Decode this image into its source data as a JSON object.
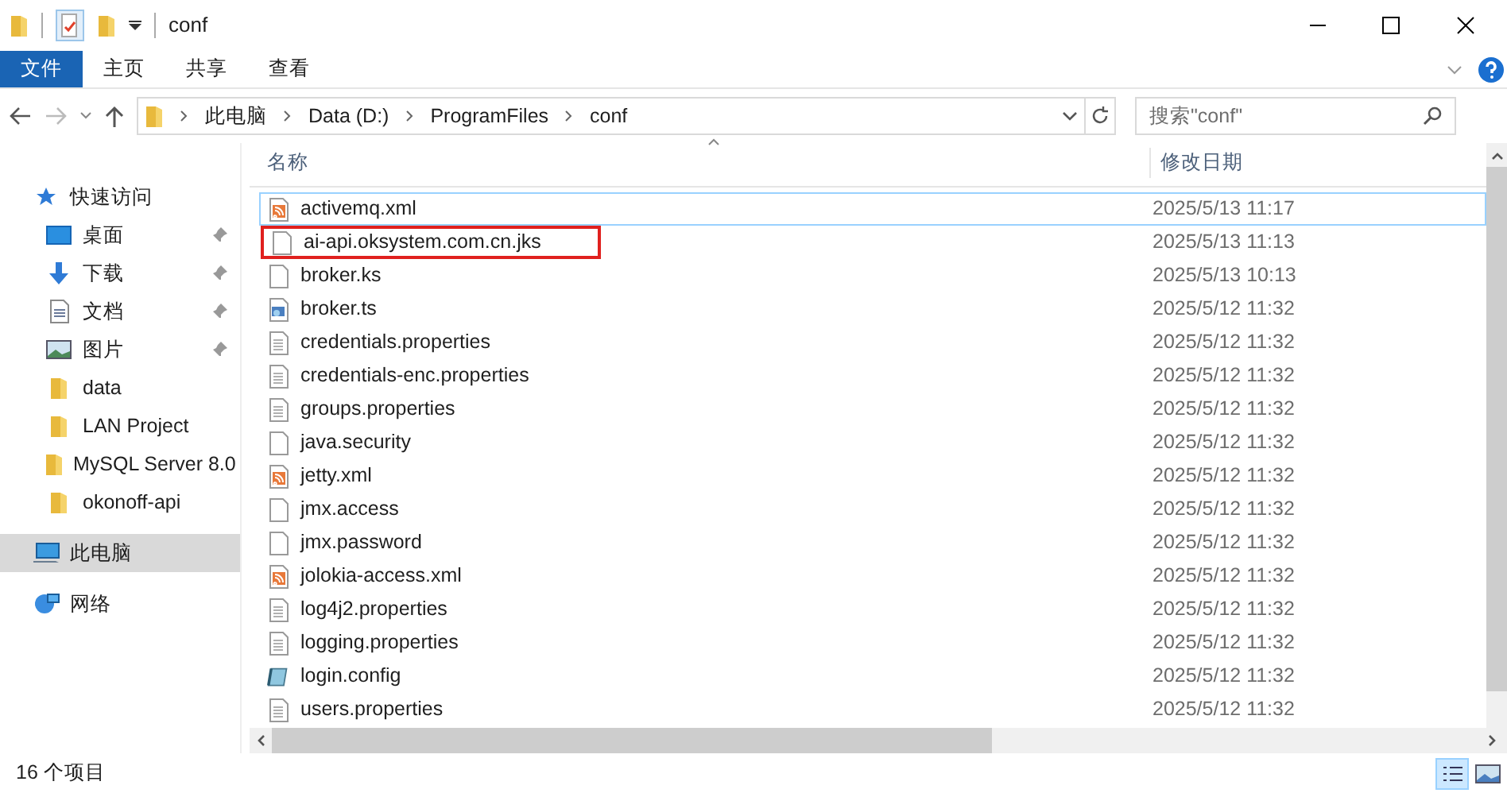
{
  "window": {
    "title": "conf"
  },
  "ribbon_tabs": [
    {
      "label": "文件",
      "selected": true
    },
    {
      "label": "主页",
      "selected": false
    },
    {
      "label": "共享",
      "selected": false
    },
    {
      "label": "查看",
      "selected": false
    }
  ],
  "address": {
    "path": [
      "此电脑",
      "Data (D:)",
      "ProgramFiles",
      "conf"
    ]
  },
  "search": {
    "placeholder": "搜索\"conf\""
  },
  "sidebar": {
    "items": [
      {
        "label": "快速访问",
        "kind": "star",
        "pinned": false,
        "selected": false,
        "children": [
          {
            "label": "桌面",
            "kind": "desktop",
            "pinned": true,
            "selected": false
          },
          {
            "label": "下载",
            "kind": "download",
            "pinned": true,
            "selected": false
          },
          {
            "label": "文档",
            "kind": "document",
            "pinned": true,
            "selected": false
          },
          {
            "label": "图片",
            "kind": "picture",
            "pinned": true,
            "selected": false
          },
          {
            "label": "data",
            "kind": "folder",
            "pinned": false,
            "selected": false
          },
          {
            "label": "LAN Project",
            "kind": "folder",
            "pinned": false,
            "selected": false
          },
          {
            "label": "MySQL Server 8.0",
            "kind": "folder",
            "pinned": false,
            "selected": false
          },
          {
            "label": "okonoff-api",
            "kind": "folder",
            "pinned": false,
            "selected": false
          }
        ]
      },
      {
        "label": "此电脑",
        "kind": "computer",
        "pinned": false,
        "selected": true
      },
      {
        "label": "网络",
        "kind": "network",
        "pinned": false,
        "selected": false
      }
    ]
  },
  "table": {
    "columns": [
      "名称",
      "修改日期"
    ],
    "rows": [
      {
        "name": "activemq.xml",
        "date": "2025/5/13 11:17",
        "kind": "xml",
        "focused": true,
        "outlined": false
      },
      {
        "name": "ai-api.oksystem.com.cn.jks",
        "date": "2025/5/13 11:13",
        "kind": "blank",
        "focused": false,
        "outlined": true
      },
      {
        "name": "broker.ks",
        "date": "2025/5/13 10:13",
        "kind": "blank",
        "focused": false,
        "outlined": false
      },
      {
        "name": "broker.ts",
        "date": "2025/5/12 11:32",
        "kind": "cert",
        "focused": false,
        "outlined": false
      },
      {
        "name": "credentials.properties",
        "date": "2025/5/12 11:32",
        "kind": "text",
        "focused": false,
        "outlined": false
      },
      {
        "name": "credentials-enc.properties",
        "date": "2025/5/12 11:32",
        "kind": "text",
        "focused": false,
        "outlined": false
      },
      {
        "name": "groups.properties",
        "date": "2025/5/12 11:32",
        "kind": "text",
        "focused": false,
        "outlined": false
      },
      {
        "name": "java.security",
        "date": "2025/5/12 11:32",
        "kind": "blank",
        "focused": false,
        "outlined": false
      },
      {
        "name": "jetty.xml",
        "date": "2025/5/12 11:32",
        "kind": "xml",
        "focused": false,
        "outlined": false
      },
      {
        "name": "jmx.access",
        "date": "2025/5/12 11:32",
        "kind": "blank",
        "focused": false,
        "outlined": false
      },
      {
        "name": "jmx.password",
        "date": "2025/5/12 11:32",
        "kind": "blank",
        "focused": false,
        "outlined": false
      },
      {
        "name": "jolokia-access.xml",
        "date": "2025/5/12 11:32",
        "kind": "xml",
        "focused": false,
        "outlined": false
      },
      {
        "name": "log4j2.properties",
        "date": "2025/5/12 11:32",
        "kind": "text",
        "focused": false,
        "outlined": false
      },
      {
        "name": "logging.properties",
        "date": "2025/5/12 11:32",
        "kind": "text",
        "focused": false,
        "outlined": false
      },
      {
        "name": "login.config",
        "date": "2025/5/12 11:32",
        "kind": "config",
        "focused": false,
        "outlined": false
      },
      {
        "name": "users.properties",
        "date": "2025/5/12 11:32",
        "kind": "text",
        "focused": false,
        "outlined": false
      }
    ]
  },
  "status_bar": {
    "count": "16 个项目"
  }
}
